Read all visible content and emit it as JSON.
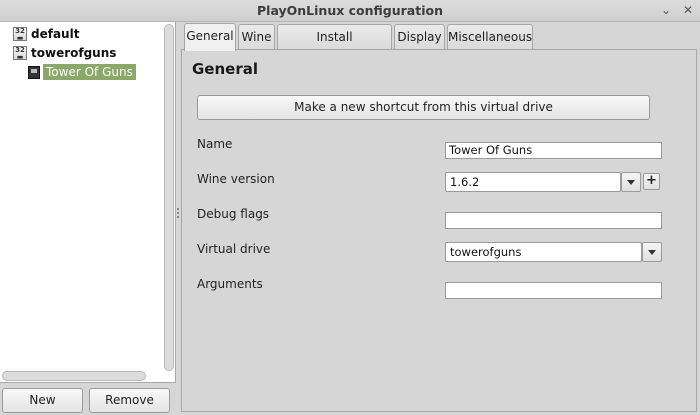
{
  "window": {
    "title": "PlayOnLinux configuration",
    "minimize_glyph": "⌄",
    "close_glyph": "✕"
  },
  "tree": {
    "items": [
      {
        "label": "default",
        "icon": "wine-prefix-icon",
        "icon_text": "32"
      },
      {
        "label": "towerofguns",
        "icon": "wine-prefix-icon",
        "icon_text": "32"
      }
    ],
    "child": {
      "label": "Tower Of Guns",
      "icon": "app-shortcut-icon",
      "selected": true
    }
  },
  "buttons": {
    "new": "New",
    "remove": "Remove"
  },
  "tabs": [
    {
      "label": "General",
      "active": true
    },
    {
      "label": "Wine",
      "active": false
    },
    {
      "label": "Install components",
      "active": false
    },
    {
      "label": "Display",
      "active": false
    },
    {
      "label": "Miscellaneous",
      "active": false
    }
  ],
  "general": {
    "heading": "General",
    "shortcut_button": "Make a new shortcut from this virtual drive",
    "name_label": "Name",
    "name_value": "Tower Of Guns",
    "wine_version_label": "Wine version",
    "wine_version_value": "1.6.2",
    "add_version_glyph": "+",
    "debug_flags_label": "Debug flags",
    "debug_flags_value": "",
    "virtual_drive_label": "Virtual drive",
    "virtual_drive_value": "towerofguns",
    "arguments_label": "Arguments",
    "arguments_value": ""
  },
  "colors": {
    "selection": "#8aa86a"
  }
}
